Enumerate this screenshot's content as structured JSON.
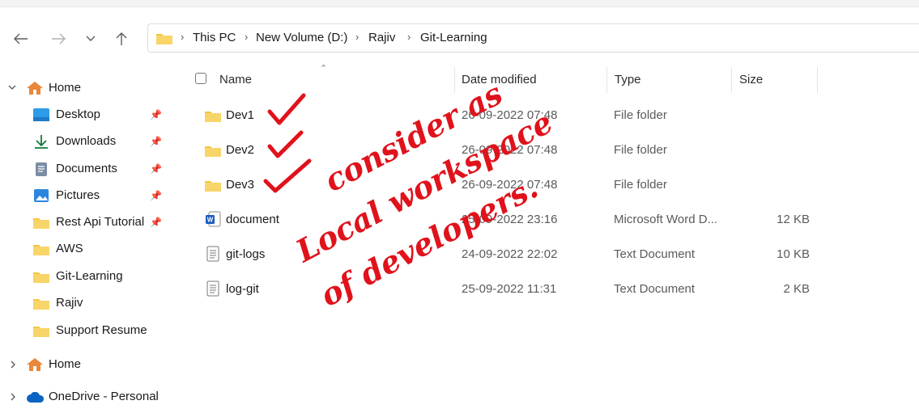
{
  "breadcrumb": [
    "This PC",
    "New Volume (D:)",
    "Rajiv",
    "Git-Learning"
  ],
  "sidebar": {
    "home_label": "Home",
    "pinned": [
      {
        "label": "Desktop",
        "icon": "desktop-icon"
      },
      {
        "label": "Downloads",
        "icon": "download-arrow-icon"
      },
      {
        "label": "Documents",
        "icon": "documents-icon"
      },
      {
        "label": "Pictures",
        "icon": "pictures-icon"
      },
      {
        "label": "Rest Api Tutorial",
        "icon": "folder-icon"
      },
      {
        "label": "AWS",
        "icon": "folder-icon"
      },
      {
        "label": "Git-Learning",
        "icon": "folder-icon"
      },
      {
        "label": "Rajiv",
        "icon": "folder-icon"
      },
      {
        "label": "Support Resume",
        "icon": "folder-icon"
      }
    ],
    "home2_label": "Home",
    "onedrive_label": "OneDrive - Personal"
  },
  "columns": {
    "name": "Name",
    "date": "Date modified",
    "type": "Type",
    "size": "Size"
  },
  "files": [
    {
      "name": "Dev1",
      "date": "26-09-2022 07:48",
      "type": "File folder",
      "size": "",
      "icon": "folder-icon"
    },
    {
      "name": "Dev2",
      "date": "26-09-2022 07:48",
      "type": "File folder",
      "size": "",
      "icon": "folder-icon"
    },
    {
      "name": "Dev3",
      "date": "26-09-2022 07:48",
      "type": "File folder",
      "size": "",
      "icon": "folder-icon"
    },
    {
      "name": "document",
      "date": "25-09-2022 23:16",
      "type": "Microsoft Word D...",
      "size": "12 KB",
      "icon": "word-document-icon"
    },
    {
      "name": "git-logs",
      "date": "24-09-2022 22:02",
      "type": "Text Document",
      "size": "10 KB",
      "icon": "text-file-icon"
    },
    {
      "name": "log-git",
      "date": "25-09-2022 11:31",
      "type": "Text Document",
      "size": "2 KB",
      "icon": "text-file-icon"
    }
  ],
  "annotation": {
    "lines": [
      "consider as",
      "Local workspace",
      "of developers."
    ],
    "color": "#e0121b"
  },
  "colors": {
    "folder": "#f4c542",
    "home": "#e9873b",
    "accent": "#0067c0"
  }
}
